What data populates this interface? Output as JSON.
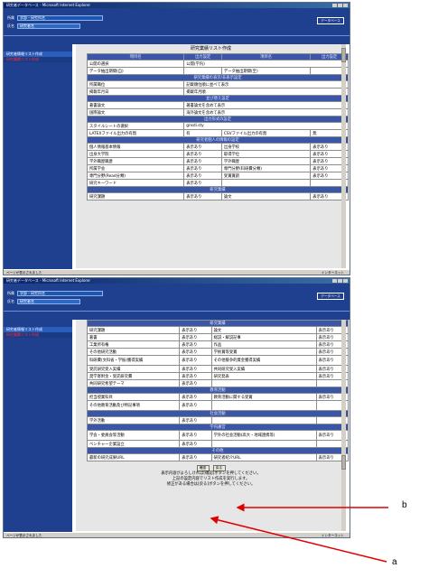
{
  "window": {
    "title": "研究者データベース - Microsoft Internet Explorer"
  },
  "header": {
    "label1": "所属",
    "field1": "学部・研究科名",
    "label2": "氏名",
    "field2": "研究者名",
    "logo": "データベース"
  },
  "sidebar": {
    "items": [
      "研究者情報リスト作成",
      "研究業績リスト作成"
    ]
  },
  "page_title": "研究業績リスト作成",
  "top": {
    "headers": [
      "項目名",
      "出力設定",
      "項目名",
      "出力設定"
    ],
    "rows": [
      [
        "公開の選択",
        "公開(学内)",
        "",
        ""
      ],
      [
        "データ抽出期間(自)",
        "",
        "データ抽出期間(至)",
        ""
      ]
    ]
  },
  "sections": {
    "s1": "研究業績の表示/非表示設定",
    "s2": "並び替え設定",
    "s3": "出力形式の設定",
    "s4": "研究者個人の情報の設定",
    "s5": "研究業績",
    "s6": "教育活動",
    "s7": "社会活動",
    "s8": "学内運営",
    "s9": "その他"
  },
  "shot1_rows": {
    "r1": [
      "所属職位",
      "記載順位順に並べて表示"
    ],
    "r2": [
      "掲載年月日",
      "掲載年月順"
    ],
    "r3": [
      "著書論文",
      "著書論文を含めて表示"
    ],
    "r4": [
      "国際論文",
      "海外論文を含めて表示"
    ],
    "r5": [
      "スタイルシートの選択",
      "gnsdi.sty"
    ],
    "r6": [
      "LATEXファイル出力の有無",
      "有",
      "CSVファイル出力の有無",
      "無"
    ],
    "r7": [
      "個人情報基本情報",
      "表示あり",
      "出身学校",
      "表示あり"
    ],
    "r8": [
      "出身大学院",
      "表示あり",
      "取得学位",
      "表示あり"
    ],
    "r9": [
      "学外職歴職歴",
      "表示あり",
      "学外職歴",
      "表示あり"
    ],
    "r10": [
      "所属学会",
      "表示あり",
      "専門分野(科研費分類)",
      "表示あり"
    ],
    "r11": [
      "専門分野(Read分類)",
      "表示あり",
      "受賞賞罰",
      "表示あり"
    ],
    "r12": [
      "研究キーワード",
      "表示あり",
      "",
      ""
    ],
    "r13": [
      "研究課題",
      "表示あり",
      "論文",
      "表示あり"
    ]
  },
  "shot2_rows": {
    "a1": [
      "研究課題",
      "表示あり",
      "論文",
      "表示あり"
    ],
    "a2": [
      "著書",
      "表示あり",
      "総説・解説記事",
      "表示あり"
    ],
    "a3": [
      "工業所有権",
      "表示あり",
      "作品",
      "表示あり"
    ],
    "a4": [
      "その他研究活動",
      "表示あり",
      "学術賞等受賞",
      "表示あり"
    ],
    "a5": [
      "科研費(文科省・学振)獲得実績",
      "表示あり",
      "その他競争的資金獲得実績",
      "表示あり"
    ],
    "a6": [
      "受託研究受入実績",
      "表示あり",
      "共同研究受入実績",
      "表示あり"
    ],
    "a7": [
      "奨学寄附金・受託研究費",
      "表示あり",
      "研究発表",
      "表示あり"
    ],
    "a8": [
      "共同研究希望テーマ",
      "表示あり",
      "",
      ""
    ],
    "b1": [
      "担当授業科目",
      "表示あり",
      "教育活動に関する受賞",
      "表示あり"
    ],
    "b2": [
      "その他教育活動及び特記事項",
      "表示あり",
      "",
      ""
    ],
    "c1": [
      "学外活動",
      "表示あり",
      "",
      ""
    ],
    "d1": [
      "学会・委員会等活動",
      "表示あり",
      "学外の社会活動(高大・地域連携等)",
      "表示あり"
    ],
    "d2": [
      "ベンチャー企業設立",
      "表示あり",
      "",
      ""
    ],
    "e1": [
      "最新の研究成果URL",
      "表示あり",
      "研究者紹介URL",
      "表示あり"
    ]
  },
  "buttons": {
    "a": "確認",
    "b": "戻る"
  },
  "notes": [
    "表示内容がよろしければ[確認]ボタンを押してください。",
    "上記の設定内容でリスト作成を実行します。",
    "修正がある場合は[戻る]ボタンを押してください。"
  ],
  "status": {
    "left": "ページが表示されました",
    "right": "インターネット"
  },
  "callouts": {
    "a": "a",
    "b": "b"
  }
}
